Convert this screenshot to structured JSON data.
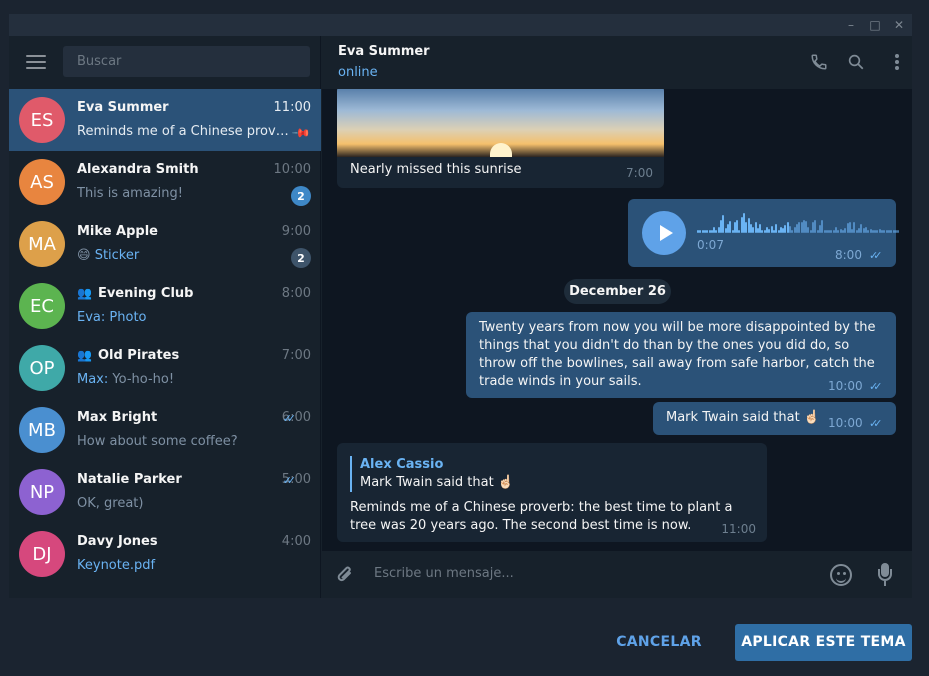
{
  "titlebar": {
    "min_icon": "minimize-icon",
    "max_icon": "maximize-icon",
    "close_icon": "close-icon"
  },
  "sidebar": {
    "search_placeholder": "Buscar",
    "chats": [
      {
        "initials": "ES",
        "name": "Eva Summer",
        "time": "11:00",
        "preview": "Reminds me of a Chinese prover...",
        "color": "#e05a6a",
        "pinned": true
      },
      {
        "initials": "AS",
        "name": "Alexandra Smith",
        "time": "10:00",
        "preview": "This is amazing!",
        "color": "#e8853f",
        "badge": "2",
        "badge_color": "#3e88c7"
      },
      {
        "initials": "MA",
        "name": "Mike Apple",
        "time": "9:00",
        "preview_prefix": "😄",
        "preview": "Sticker",
        "color": "#dda04a",
        "badge": "2",
        "badge_color": "#3e546a"
      },
      {
        "initials": "EC",
        "name": "Evening Club",
        "time": "8:00",
        "preview_prefix": "Eva:",
        "preview": "Photo",
        "color": "#5cb450",
        "group": true
      },
      {
        "initials": "OP",
        "name": "Old Pirates",
        "time": "7:00",
        "preview_prefix": "Max:",
        "preview": "Yo-ho-ho!",
        "color": "#3fa9a8",
        "group": true
      },
      {
        "initials": "MB",
        "name": "Max Bright",
        "time": "6:00",
        "preview": "How about some coffee?",
        "color": "#4a8fd0",
        "read": true
      },
      {
        "initials": "NP",
        "name": "Natalie Parker",
        "time": "5:00",
        "preview": "OK, great)",
        "color": "#8d62d1",
        "read": true
      },
      {
        "initials": "DJ",
        "name": "Davy Jones",
        "time": "4:00",
        "preview": "Keynote.pdf",
        "color": "#d6487d"
      }
    ]
  },
  "chat": {
    "title": "Eva Summer",
    "status": "online",
    "messages": {
      "photo_caption": "Nearly missed this sunrise",
      "photo_time": "7:00",
      "voice_duration": "0:07",
      "voice_time": "8:00",
      "date": "December 26",
      "quote": "Twenty years from now you will be more disappointed by the things that you didn't do than by the ones you did do, so throw off the bowlines, sail away from safe harbor, catch the trade winds in your sails.",
      "quote_time": "10:00",
      "short": "Mark Twain said that ☝🏻",
      "short_time": "10:00",
      "reply_name": "Alex Cassio",
      "reply_text": "Mark Twain said that ☝🏻",
      "reply_body": "Reminds me of a Chinese proverb: the best time to plant a tree was 20 years ago. The second best time is now.",
      "reply_time": "11:00"
    },
    "composer_placeholder": "Escribe un mensaje..."
  },
  "footer": {
    "cancel": "CANCELAR",
    "apply": "APLICAR ESTE TEMA"
  }
}
